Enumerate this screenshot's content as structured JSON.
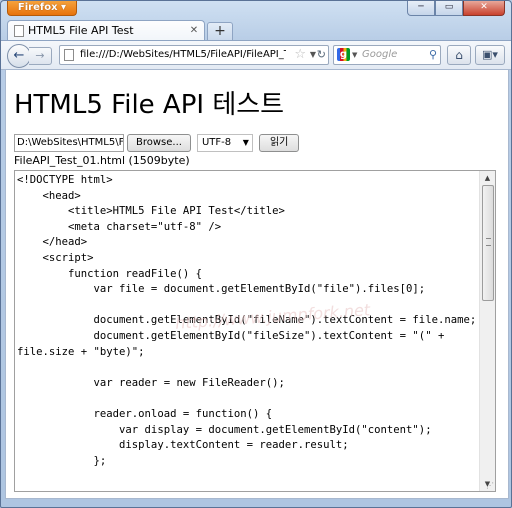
{
  "browser": {
    "app_button": "Firefox",
    "window_controls": {
      "minimize": "─",
      "restore": "▭",
      "close": "✕"
    }
  },
  "tabs": [
    {
      "label": "HTML5 File API Test",
      "close": "✕"
    }
  ],
  "new_tab_label": "+",
  "navbar": {
    "back": "←",
    "forward": "→",
    "url": "file:///D:/WebSites/HTML5/FileAPI/FileAPI_Test_",
    "search_placeholder": "Google",
    "search_engine_letter": "g"
  },
  "page": {
    "title": "HTML5 File API 테스트",
    "file_path": "D:\\WebSites\\HTML5\\F",
    "browse_label": "Browse...",
    "encoding_selected": "UTF-8",
    "read_button": "읽기",
    "file_info": "FileAPI_Test_01.html (1509byte)",
    "watermark": "http://www.jumpfork.net",
    "code": "<!DOCTYPE html>\n    <head>\n        <title>HTML5 File API Test</title>\n        <meta charset=\"utf-8\" />\n    </head>\n    <script>\n        function readFile() {\n            var file = document.getElementById(\"file\").files[0];\n\n            document.getElementById(\"fileName\").textContent = file.name;\n            document.getElementById(\"fileSize\").textContent = \"(\" +\nfile.size + \"byte)\";\n\n            var reader = new FileReader();\n\n            reader.onload = function() {\n                var display = document.getElementById(\"content\");\n                display.textContent = reader.result;\n            };"
  }
}
